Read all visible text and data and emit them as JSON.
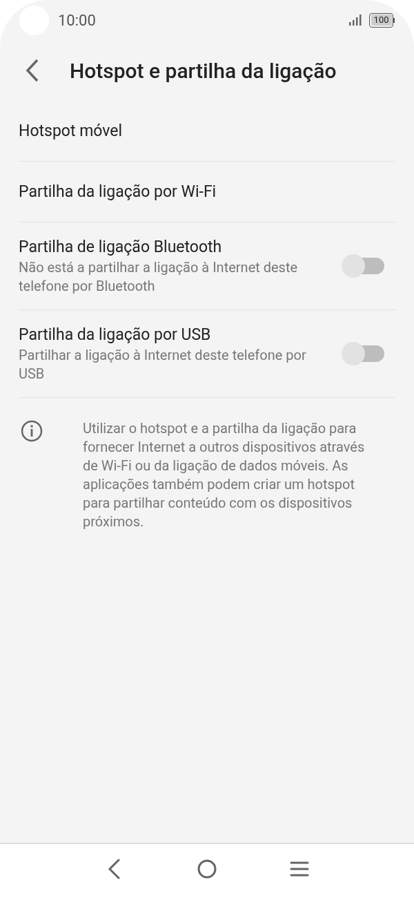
{
  "status_bar": {
    "time": "10:00",
    "battery": "100"
  },
  "header": {
    "title": "Hotspot e partilha da ligação"
  },
  "items": [
    {
      "kind": "link",
      "title": "Hotspot móvel"
    },
    {
      "kind": "link",
      "title": "Partilha da ligação por Wi-Fi"
    },
    {
      "kind": "toggle",
      "title": "Partilha de ligação Bluetooth",
      "subtitle": "Não está a partilhar a ligação à Internet deste telefone por Bluetooth",
      "on": false
    },
    {
      "kind": "toggle",
      "title": "Partilha da ligação por USB",
      "subtitle": "Partilhar a ligação à Internet deste telefone por USB",
      "on": false
    }
  ],
  "info": "Utilizar o hotspot e a partilha da ligação para fornecer Internet a outros dispositivos através de Wi-Fi ou da ligação de dados móveis. As aplicações também podem criar um hotspot para partilhar conteúdo com os dispositivos próximos."
}
